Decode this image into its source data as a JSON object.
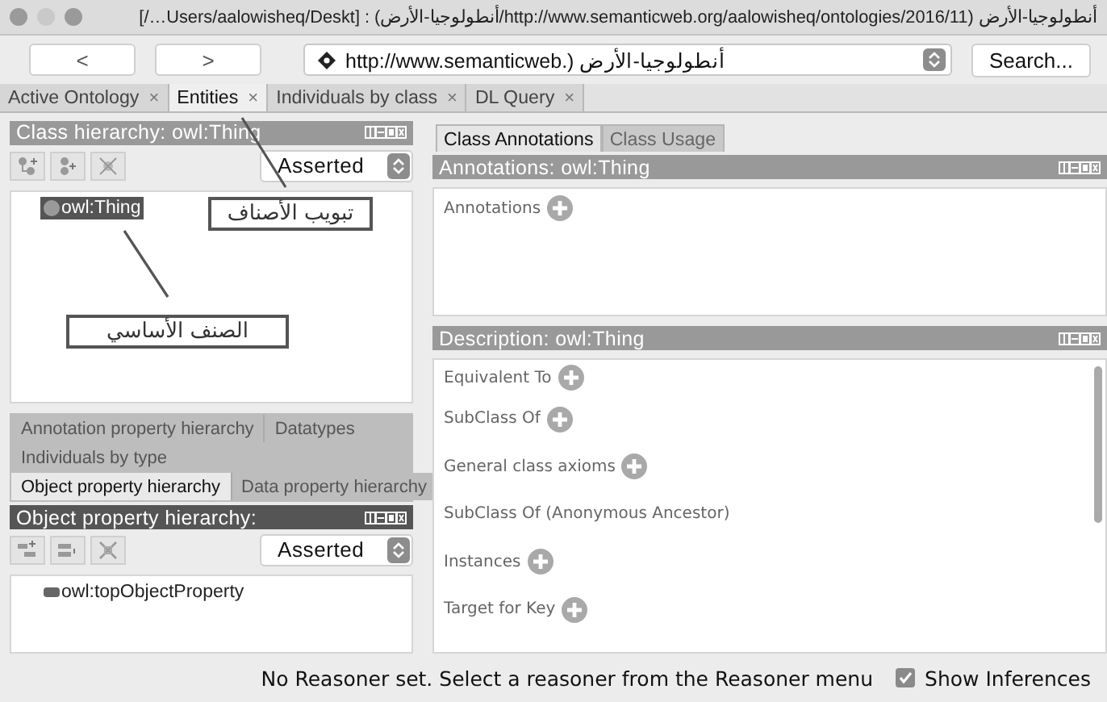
{
  "window": {
    "title": "أنطولوجيا-الأرض (http://www.semanticweb.org/aalowisheq/ontologies/2016/11/أنطولوجيا-الأرض) : [Users/aalowisheq/Deskt…/]"
  },
  "nav": {
    "back": "<",
    "forward": ">",
    "url": "http://www.semanticweb.) أنطولوجيا-الأرض",
    "search_button": "Search..."
  },
  "workspace_tabs": [
    {
      "label": "Active Ontology",
      "close": "×",
      "selected": false
    },
    {
      "label": "Entities",
      "close": "×",
      "selected": true
    },
    {
      "label": "Individuals by class",
      "close": "×",
      "selected": false
    },
    {
      "label": "DL Query",
      "close": "×",
      "selected": false
    }
  ],
  "class_hierarchy": {
    "title": "Class hierarchy: owl:Thing",
    "mode": "Asserted",
    "tree": [
      {
        "label": "owl:Thing",
        "selected": true
      }
    ]
  },
  "callouts": [
    {
      "text": "تبويب الأصناف"
    },
    {
      "text": "الصنف الأساسي"
    }
  ],
  "left_tabs": {
    "rows": [
      [
        {
          "label": "Annotation property hierarchy",
          "selected": false
        },
        {
          "label": "Datatypes",
          "selected": false
        }
      ],
      [
        {
          "label": "Individuals by type",
          "selected": false
        }
      ],
      [
        {
          "label": "Object property hierarchy",
          "selected": true
        },
        {
          "label": "Data property hierarchy",
          "selected": false
        }
      ]
    ]
  },
  "property_hierarchy": {
    "title": "Object property hierarchy:",
    "mode": "Asserted",
    "tree": [
      {
        "label": "owl:topObjectProperty",
        "selected": false
      }
    ]
  },
  "right_tabs": [
    {
      "label": "Class Annotations",
      "selected": true
    },
    {
      "label": "Class Usage",
      "selected": false
    }
  ],
  "annotations": {
    "title": "Annotations: owl:Thing",
    "items": [
      {
        "label": "Annotations",
        "addable": true
      }
    ]
  },
  "description": {
    "title": "Description: owl:Thing",
    "items": [
      {
        "label": "Equivalent To",
        "addable": true
      },
      {
        "label": "SubClass Of",
        "addable": true
      },
      {
        "label": "General class axioms",
        "addable": true
      },
      {
        "label": "SubClass Of (Anonymous Ancestor)",
        "addable": false
      },
      {
        "label": "Instances",
        "addable": true
      },
      {
        "label": "Target for Key",
        "addable": true
      }
    ]
  },
  "status_bar": {
    "message": "No Reasoner set. Select a reasoner from the Reasoner menu",
    "show_inferences": {
      "label": "Show Inferences",
      "checked": true
    }
  }
}
